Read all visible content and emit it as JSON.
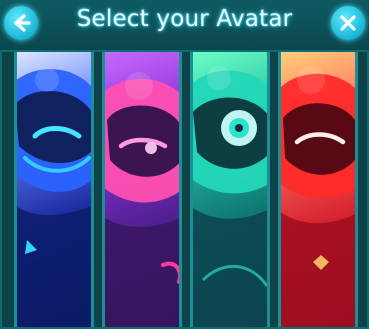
{
  "header": {
    "title": "Select your Avatar",
    "back_icon": "arrow-left-icon",
    "close_icon": "close-icon"
  },
  "avatars": [
    {
      "id": "blue",
      "accent": "#2aa7ff"
    },
    {
      "id": "magenta",
      "accent": "#ff3b9d"
    },
    {
      "id": "teal",
      "accent": "#2ff0c9"
    },
    {
      "id": "red",
      "accent": "#ff2a2a"
    }
  ],
  "colors": {
    "header_bg": "#0f5a62",
    "button": "#1fb8d8",
    "title_glow": "#2fd6f0",
    "divider": "#1a8f96"
  }
}
